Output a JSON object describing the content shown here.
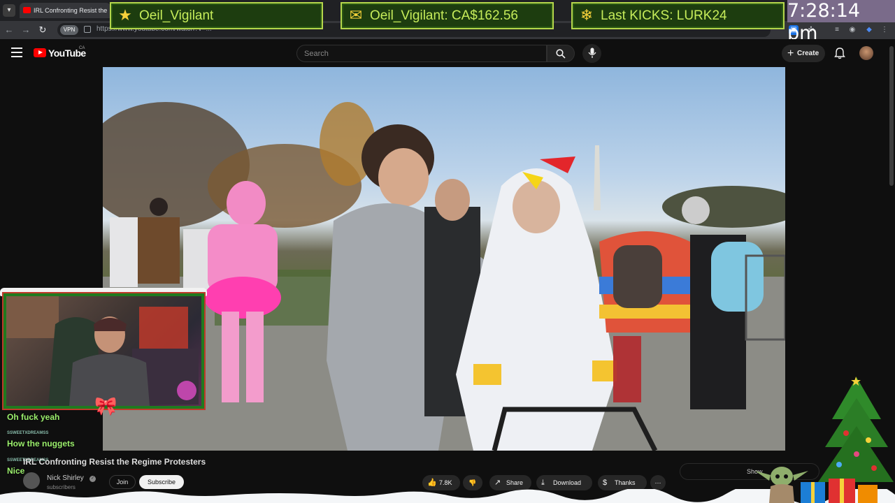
{
  "browser": {
    "tab_title": "IRL Confronting Resist the",
    "url": "https://www.youtube.com/watch?v=...",
    "vpn_label": "VPN"
  },
  "overlay": {
    "follower_label": "Oeil_Vigilant",
    "tip_label": "Oeil_Vigilant: CA$162.56",
    "kicks_label": "Last KICKS: LURK24",
    "clock": "7:28:14 pm"
  },
  "youtube": {
    "logo_text": "YouTube",
    "country_code": "CA",
    "search_placeholder": "Search",
    "create_label": "Create"
  },
  "chat": [
    {
      "user": "",
      "message": "Oh fuck yeah"
    },
    {
      "user": "SSWEETXDREAMSS",
      "message": "How the nuggets"
    },
    {
      "user": "SSWEETXDREAMSS",
      "message": "Nice"
    }
  ],
  "video": {
    "title": "IRL Confronting Resist the Regime Protesters",
    "channel": "Nick Shirley",
    "subscribers": "subscribers",
    "join_label": "Join",
    "subscribe_label": "Subscribe",
    "likes": "7.8K",
    "share_label": "Share",
    "download_label": "Download",
    "thanks_label": "Thanks",
    "show_more_label": "Show"
  },
  "colors": {
    "banner_bg": "#1d3d0f",
    "banner_border": "#b5d64b",
    "banner_text": "#c6ec5a",
    "chat_text": "#9cf06d",
    "youtube_red": "#ff0000"
  }
}
